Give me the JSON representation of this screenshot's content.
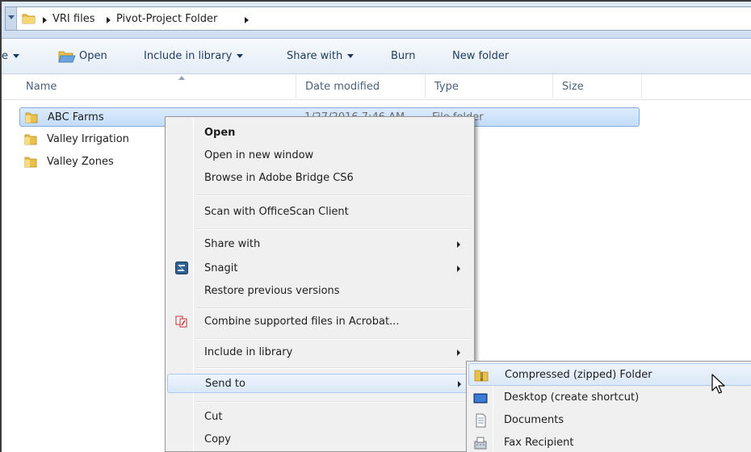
{
  "address_bar": {
    "crumbs": [
      "VRI files",
      "Pivot-Project Folder"
    ]
  },
  "toolbar": {
    "organize_partial": "e",
    "open": "Open",
    "include_in_library": "Include in library",
    "share_with": "Share with",
    "burn": "Burn",
    "new_folder": "New folder"
  },
  "columns": {
    "name": "Name",
    "date_modified": "Date modified",
    "type": "Type",
    "size": "Size"
  },
  "files": [
    {
      "name": "ABC Farms",
      "date": "1/27/2016 7:46 AM",
      "type": "File folder",
      "selected": true
    },
    {
      "name": "Valley Irrigation",
      "type": "der"
    },
    {
      "name": "Valley Zones",
      "type": "der"
    }
  ],
  "context_menu": {
    "items": [
      {
        "label": "Open",
        "bold": true
      },
      {
        "label": "Open in new window"
      },
      {
        "label": "Browse in Adobe Bridge CS6"
      },
      {
        "label": "Scan with OfficeScan Client"
      },
      {
        "label": "Share with",
        "submenu": true
      },
      {
        "label": "Snagit",
        "submenu": true,
        "icon": "snagit-icon"
      },
      {
        "label": "Restore previous versions"
      },
      {
        "label": "Combine supported files in Acrobat...",
        "icon": "acrobat-icon"
      },
      {
        "label": "Include in library",
        "submenu": true
      },
      {
        "label": "Send to",
        "submenu": true,
        "hover": true
      },
      {
        "label": "Cut"
      },
      {
        "label": "Copy"
      }
    ]
  },
  "send_to_menu": {
    "items": [
      {
        "label": "Compressed (zipped) Folder",
        "icon": "zip-folder-icon",
        "hover": true
      },
      {
        "label": "Desktop (create shortcut)",
        "icon": "desktop-icon"
      },
      {
        "label": "Documents",
        "icon": "documents-icon"
      },
      {
        "label": "Fax Recipient",
        "icon": "fax-icon"
      }
    ]
  },
  "colors": {
    "selection_fill": "#cce0f8",
    "selection_border": "#84acdd",
    "menu_bg": "#f0f0f0",
    "folder_yellow": "#e8c04a"
  }
}
